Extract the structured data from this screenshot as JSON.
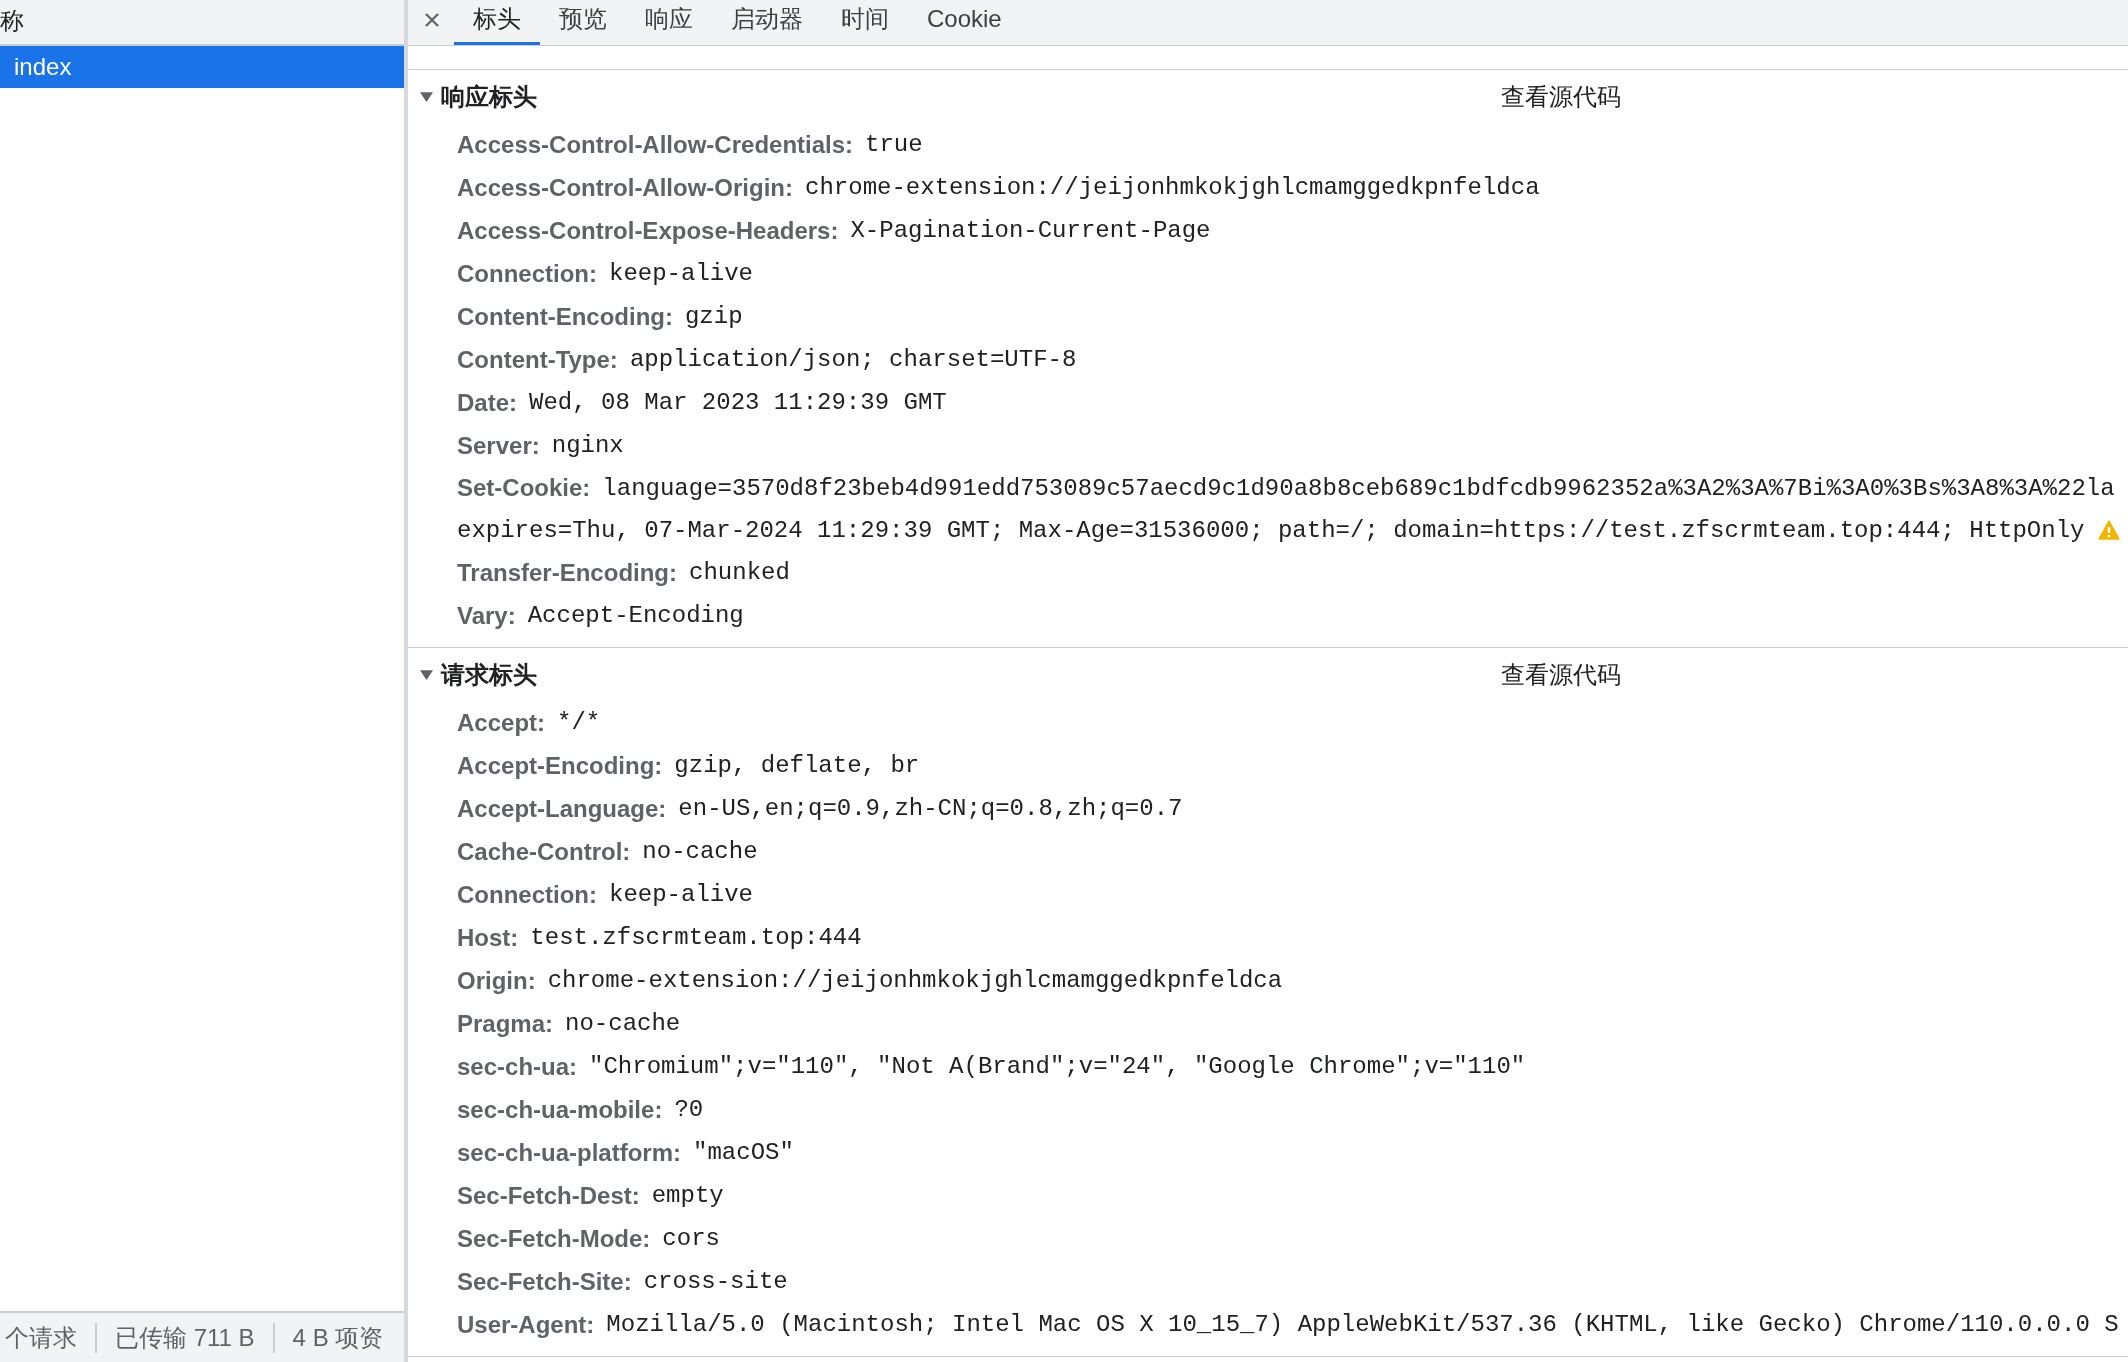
{
  "requests_panel": {
    "column_header": "称",
    "items": [
      {
        "label": "index",
        "selected": true
      }
    ],
    "status_bar": [
      "个请求",
      "已传输 711 B",
      "4 B 项资"
    ]
  },
  "tabs": [
    {
      "label": "标头",
      "selected": true
    },
    {
      "label": "预览",
      "selected": false
    },
    {
      "label": "响应",
      "selected": false
    },
    {
      "label": "启动器",
      "selected": false
    },
    {
      "label": "时间",
      "selected": false
    },
    {
      "label": "Cookie",
      "selected": false
    }
  ],
  "sections": [
    {
      "title": "响应标头",
      "expanded": true,
      "view_source": "查看源代码",
      "headers": [
        {
          "name": "Access-Control-Allow-Credentials:",
          "value": "true",
          "warning": false
        },
        {
          "name": "Access-Control-Allow-Origin:",
          "value": "chrome-extension://jeijonhmkokjghlcmamggedkpnfeldca",
          "warning": false
        },
        {
          "name": "Access-Control-Expose-Headers:",
          "value": "X-Pagination-Current-Page",
          "warning": false
        },
        {
          "name": "Connection:",
          "value": "keep-alive",
          "warning": false
        },
        {
          "name": "Content-Encoding:",
          "value": "gzip",
          "warning": false
        },
        {
          "name": "Content-Type:",
          "value": "application/json; charset=UTF-8",
          "warning": false
        },
        {
          "name": "Date:",
          "value": "Wed, 08 Mar 2023 11:29:39 GMT",
          "warning": false
        },
        {
          "name": "Server:",
          "value": "nginx",
          "warning": false
        },
        {
          "name": "Set-Cookie:",
          "value": "language=3570d8f23beb4d991edd753089c57aecd9c1d90a8b8ceb689c1bdfcdb9962352a%3A2%3A%7Bi%3A0%3Bs%3A8%3A%22la",
          "continuation": "expires=Thu, 07-Mar-2024 11:29:39 GMT; Max-Age=31536000; path=/; domain=https://test.zfscrmteam.top:444; HttpOnly",
          "warning": true
        },
        {
          "name": "Transfer-Encoding:",
          "value": "chunked",
          "warning": false
        },
        {
          "name": "Vary:",
          "value": "Accept-Encoding",
          "warning": false
        }
      ]
    },
    {
      "title": "请求标头",
      "expanded": true,
      "view_source": "查看源代码",
      "headers": [
        {
          "name": "Accept:",
          "value": "*/*",
          "warning": false
        },
        {
          "name": "Accept-Encoding:",
          "value": "gzip, deflate, br",
          "warning": false
        },
        {
          "name": "Accept-Language:",
          "value": "en-US,en;q=0.9,zh-CN;q=0.8,zh;q=0.7",
          "warning": false
        },
        {
          "name": "Cache-Control:",
          "value": "no-cache",
          "warning": false
        },
        {
          "name": "Connection:",
          "value": "keep-alive",
          "warning": false
        },
        {
          "name": "Host:",
          "value": "test.zfscrmteam.top:444",
          "warning": false
        },
        {
          "name": "Origin:",
          "value": "chrome-extension://jeijonhmkokjghlcmamggedkpnfeldca",
          "warning": false
        },
        {
          "name": "Pragma:",
          "value": "no-cache",
          "warning": false
        },
        {
          "name": "sec-ch-ua:",
          "value": "\"Chromium\";v=\"110\", \"Not A(Brand\";v=\"24\", \"Google Chrome\";v=\"110\"",
          "warning": false
        },
        {
          "name": "sec-ch-ua-mobile:",
          "value": "?0",
          "warning": false
        },
        {
          "name": "sec-ch-ua-platform:",
          "value": "\"macOS\"",
          "warning": false
        },
        {
          "name": "Sec-Fetch-Dest:",
          "value": "empty",
          "warning": false
        },
        {
          "name": "Sec-Fetch-Mode:",
          "value": "cors",
          "warning": false
        },
        {
          "name": "Sec-Fetch-Site:",
          "value": "cross-site",
          "warning": false
        },
        {
          "name": "User-Agent:",
          "value": "Mozilla/5.0 (Macintosh; Intel Mac OS X 10_15_7) AppleWebKit/537.36 (KHTML, like Gecko) Chrome/110.0.0.0 S",
          "warning": false
        }
      ]
    }
  ]
}
